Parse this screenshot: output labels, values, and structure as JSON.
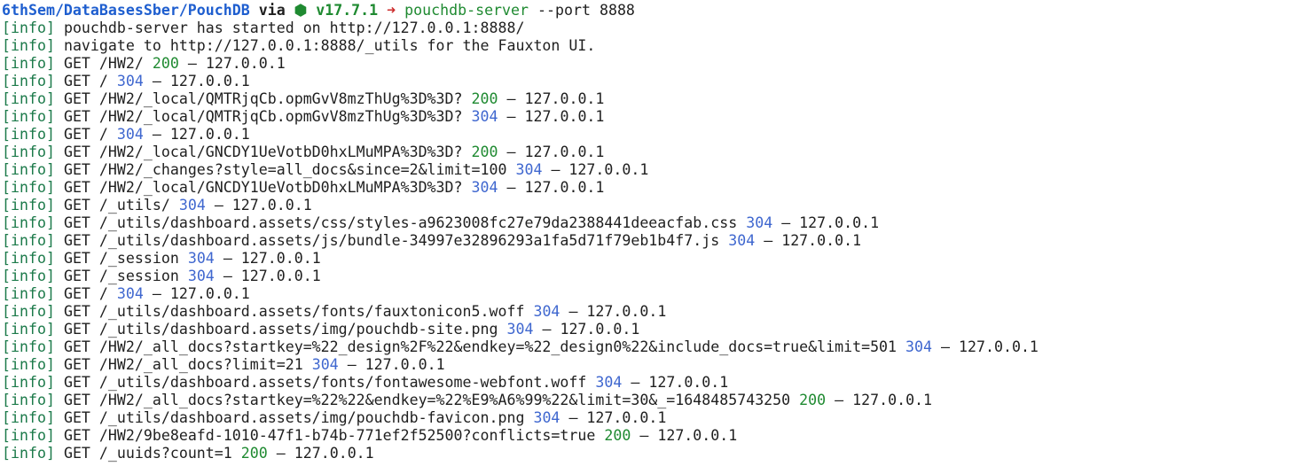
{
  "prompt": {
    "path": "6thSem/DataBasesSber/PouchDB",
    "via": "via",
    "node_icon": "⬢",
    "version": "v17.7.1",
    "arrow": "➜",
    "command": "pouchdb-server",
    "args": "--port 8888"
  },
  "log": [
    {
      "tag": "[info]",
      "msg": "pouchdb-server has started on http://127.0.0.1:8888/",
      "status": "",
      "tail": ""
    },
    {
      "tag": "[info]",
      "msg": "navigate to http://127.0.0.1:8888/_utils for the Fauxton UI.",
      "status": "",
      "tail": ""
    },
    {
      "tag": "[info]",
      "msg": "GET /HW2/",
      "status": "200",
      "tail": "– 127.0.0.1"
    },
    {
      "tag": "[info]",
      "msg": "GET /",
      "status": "304",
      "tail": "– 127.0.0.1"
    },
    {
      "tag": "[info]",
      "msg": "GET /HW2/_local/QMTRjqCb.opmGvV8mzThUg%3D%3D?",
      "status": "200",
      "tail": "– 127.0.0.1"
    },
    {
      "tag": "[info]",
      "msg": "GET /HW2/_local/QMTRjqCb.opmGvV8mzThUg%3D%3D?",
      "status": "304",
      "tail": "– 127.0.0.1"
    },
    {
      "tag": "[info]",
      "msg": "GET /",
      "status": "304",
      "tail": "– 127.0.0.1"
    },
    {
      "tag": "[info]",
      "msg": "GET /HW2/_local/GNCDY1UeVotbD0hxLMuMPA%3D%3D?",
      "status": "200",
      "tail": "– 127.0.0.1"
    },
    {
      "tag": "[info]",
      "msg": "GET /HW2/_changes?style=all_docs&since=2&limit=100",
      "status": "304",
      "tail": "– 127.0.0.1"
    },
    {
      "tag": "[info]",
      "msg": "GET /HW2/_local/GNCDY1UeVotbD0hxLMuMPA%3D%3D?",
      "status": "304",
      "tail": "– 127.0.0.1"
    },
    {
      "tag": "[info]",
      "msg": "GET /_utils/",
      "status": "304",
      "tail": "– 127.0.0.1"
    },
    {
      "tag": "[info]",
      "msg": "GET /_utils/dashboard.assets/css/styles-a9623008fc27e79da2388441deeacfab.css",
      "status": "304",
      "tail": "– 127.0.0.1"
    },
    {
      "tag": "[info]",
      "msg": "GET /_utils/dashboard.assets/js/bundle-34997e32896293a1fa5d71f79eb1b4f7.js",
      "status": "304",
      "tail": "– 127.0.0.1"
    },
    {
      "tag": "[info]",
      "msg": "GET /_session",
      "status": "304",
      "tail": "– 127.0.0.1"
    },
    {
      "tag": "[info]",
      "msg": "GET /_session",
      "status": "304",
      "tail": "– 127.0.0.1"
    },
    {
      "tag": "[info]",
      "msg": "GET /",
      "status": "304",
      "tail": "– 127.0.0.1"
    },
    {
      "tag": "[info]",
      "msg": "GET /_utils/dashboard.assets/fonts/fauxtonicon5.woff",
      "status": "304",
      "tail": "– 127.0.0.1"
    },
    {
      "tag": "[info]",
      "msg": "GET /_utils/dashboard.assets/img/pouchdb-site.png",
      "status": "304",
      "tail": "– 127.0.0.1"
    },
    {
      "tag": "[info]",
      "msg": "GET /HW2/_all_docs?startkey=%22_design%2F%22&endkey=%22_design0%22&include_docs=true&limit=501",
      "status": "304",
      "tail": "– 127.0.0.1"
    },
    {
      "tag": "[info]",
      "msg": "GET /HW2/_all_docs?limit=21",
      "status": "304",
      "tail": "– 127.0.0.1"
    },
    {
      "tag": "[info]",
      "msg": "GET /_utils/dashboard.assets/fonts/fontawesome-webfont.woff",
      "status": "304",
      "tail": "– 127.0.0.1"
    },
    {
      "tag": "[info]",
      "msg": "GET /HW2/_all_docs?startkey=%22%22&endkey=%22%E9%A6%99%22&limit=30&_=1648485743250",
      "status": "200",
      "tail": "– 127.0.0.1"
    },
    {
      "tag": "[info]",
      "msg": "GET /_utils/dashboard.assets/img/pouchdb-favicon.png",
      "status": "304",
      "tail": "– 127.0.0.1"
    },
    {
      "tag": "[info]",
      "msg": "GET /HW2/9be8eafd-1010-47f1-b74b-771ef2f52500?conflicts=true",
      "status": "200",
      "tail": "– 127.0.0.1"
    },
    {
      "tag": "[info]",
      "msg": "GET /_uuids?count=1",
      "status": "200",
      "tail": "– 127.0.0.1"
    }
  ],
  "colors": {
    "info_tag": "#1c7a4a",
    "status_200": "#1f8a31",
    "status_304": "#3f67cf",
    "prompt_path": "#1e5ecf",
    "arrow": "#cc2b2b"
  }
}
